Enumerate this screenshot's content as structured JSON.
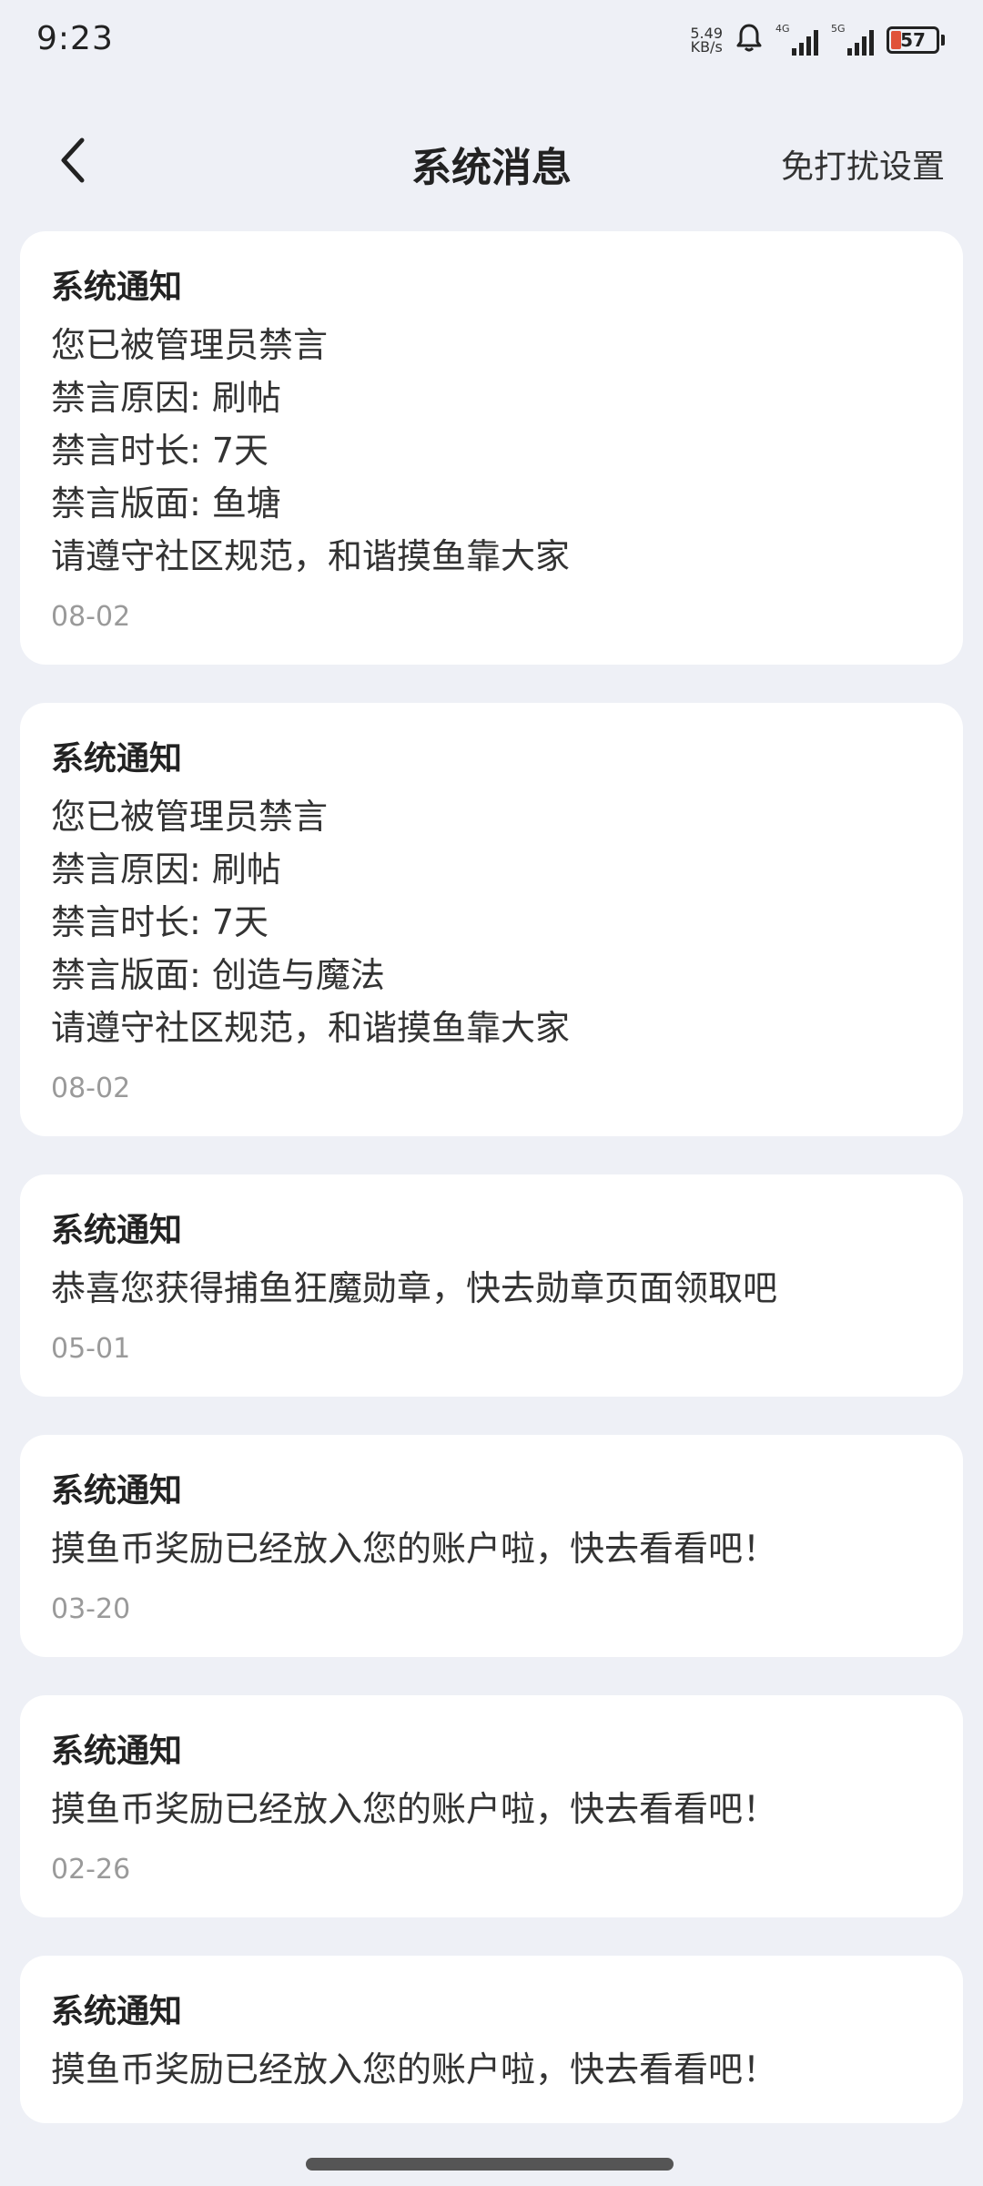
{
  "status_bar": {
    "time": "9:23",
    "net_speed_value": "5.49",
    "net_speed_unit": "KB/s",
    "signal_1_label": "4G",
    "signal_2_label": "5G",
    "battery_level": "57"
  },
  "header": {
    "title": "系统消息",
    "dnd_label": "免打扰设置"
  },
  "messages": [
    {
      "title": "系统通知",
      "lines": [
        "您已被管理员禁言",
        "禁言原因: 刷帖",
        "禁言时长: 7天",
        "禁言版面: 鱼塘",
        "请遵守社区规范，和谐摸鱼靠大家"
      ],
      "date": "08-02"
    },
    {
      "title": "系统通知",
      "lines": [
        "您已被管理员禁言",
        "禁言原因: 刷帖",
        "禁言时长: 7天",
        "禁言版面: 创造与魔法",
        "请遵守社区规范，和谐摸鱼靠大家"
      ],
      "date": "08-02"
    },
    {
      "title": "系统通知",
      "lines": [
        "恭喜您获得捕鱼狂魔勋章，快去勋章页面领取吧"
      ],
      "date": "05-01"
    },
    {
      "title": "系统通知",
      "lines": [
        "摸鱼币奖励已经放入您的账户啦，快去看看吧！"
      ],
      "date": "03-20"
    },
    {
      "title": "系统通知",
      "lines": [
        "摸鱼币奖励已经放入您的账户啦，快去看看吧！"
      ],
      "date": "02-26"
    },
    {
      "title": "系统通知",
      "lines": [
        "摸鱼币奖励已经放入您的账户啦，快去看看吧！"
      ],
      "date": ""
    }
  ],
  "colors": {
    "background": "#eef0f6",
    "card": "#ffffff",
    "date_text": "#9a9a9a",
    "battery_low": "#e0523a"
  }
}
